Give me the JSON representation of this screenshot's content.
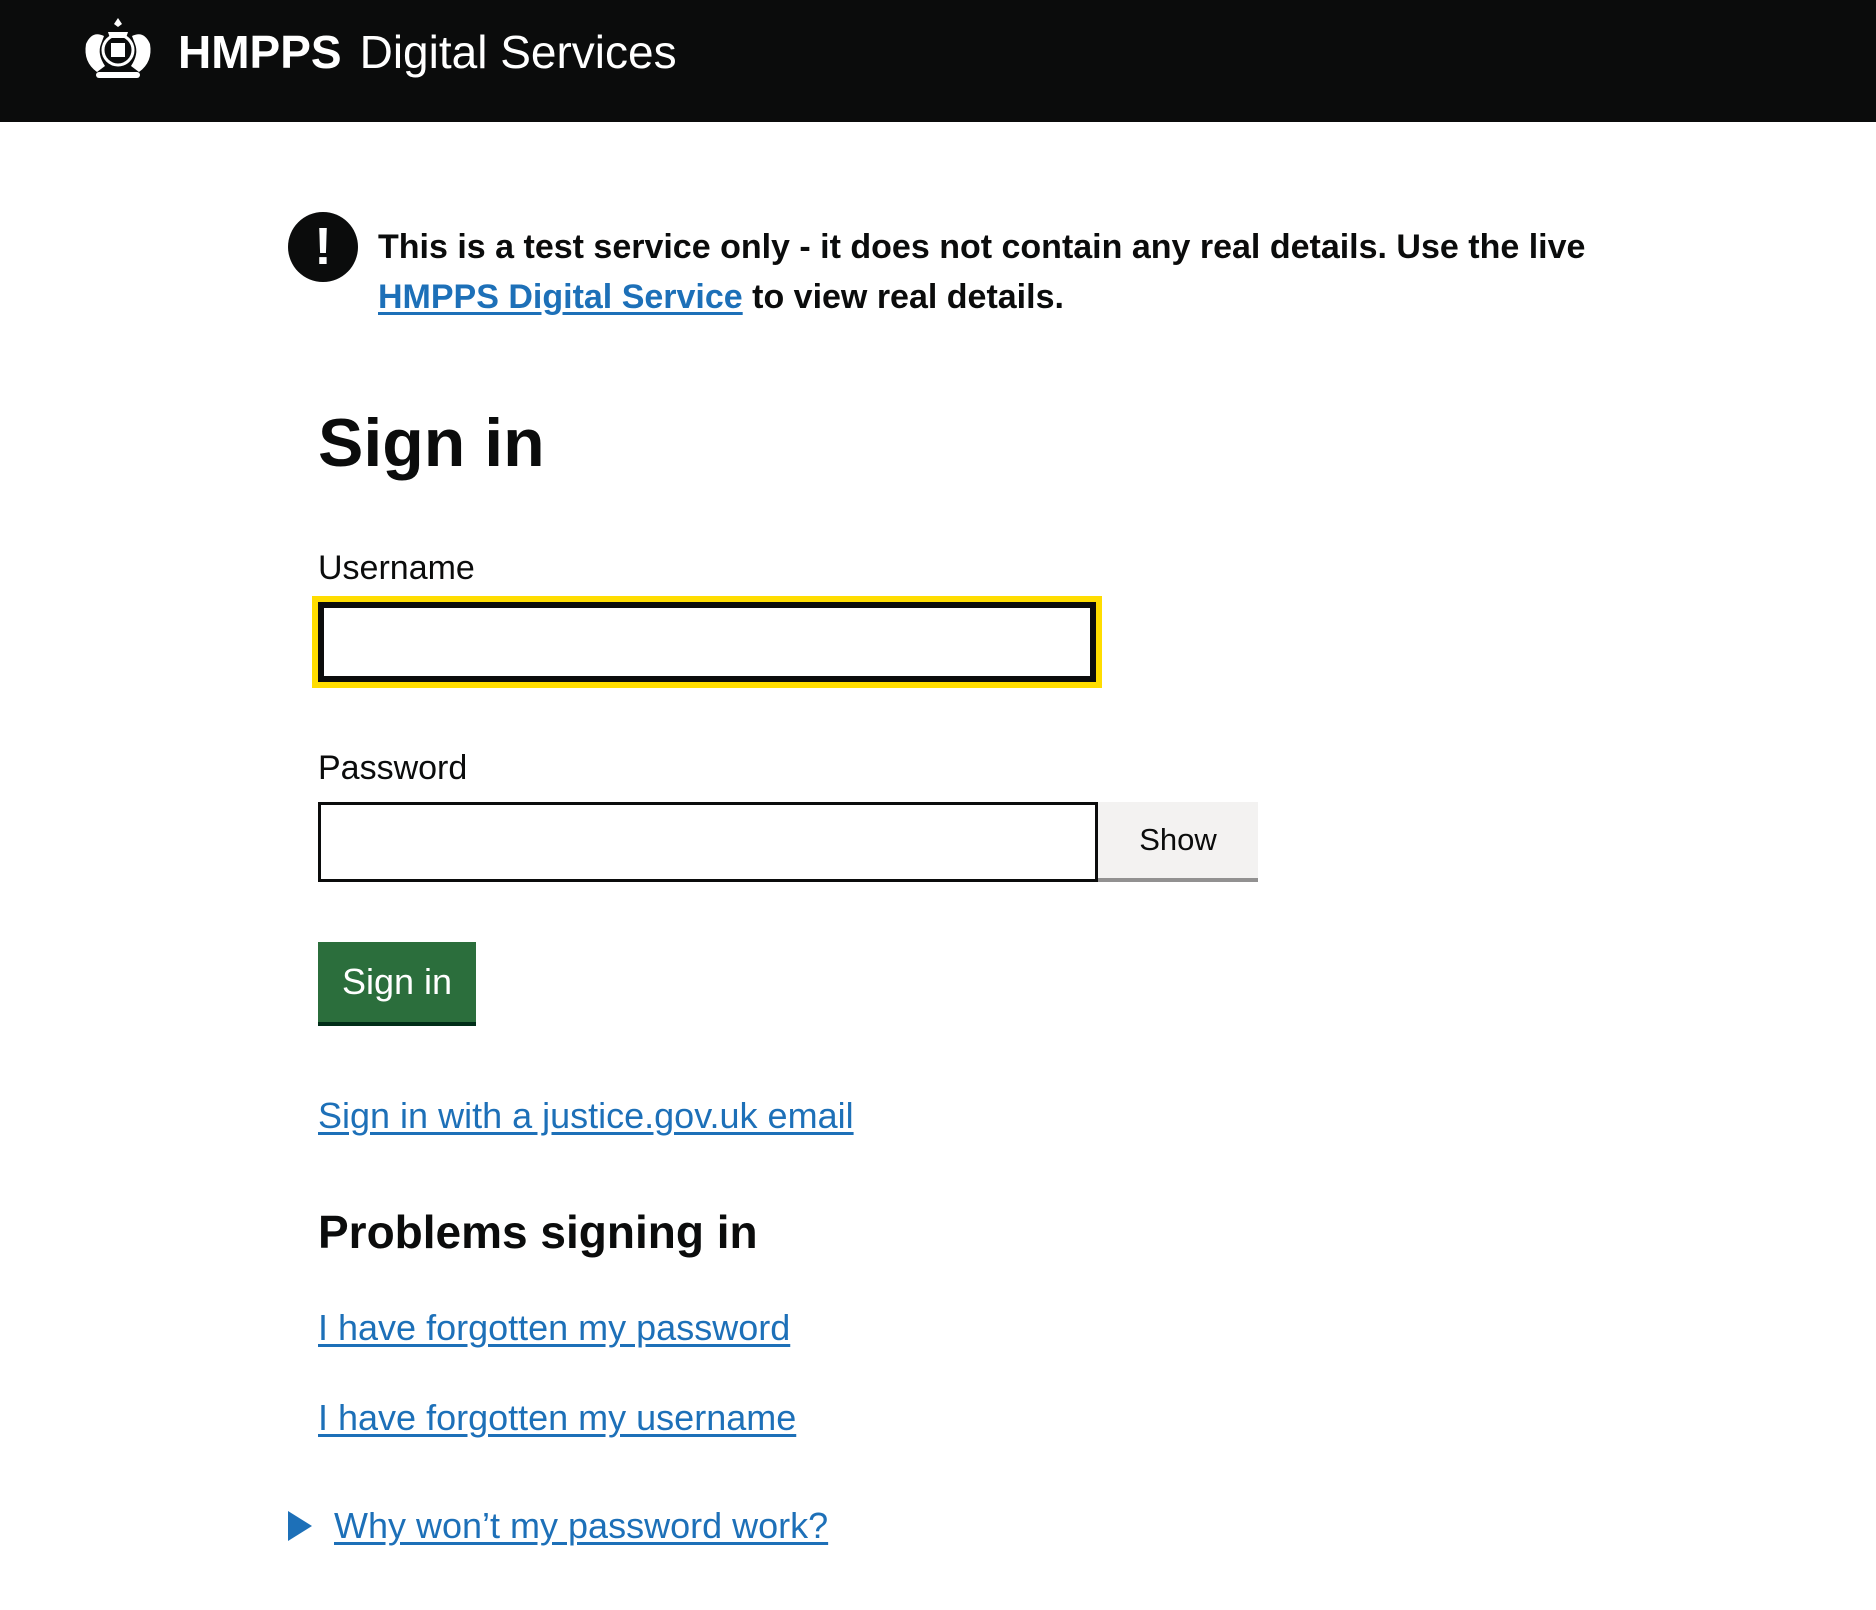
{
  "header": {
    "org_name": "HMPPS",
    "service_name": "Digital Services",
    "logo_icon": "royal-crest-icon"
  },
  "warning": {
    "icon": "exclamation-icon",
    "icon_text": "!",
    "text_before_link": "This is a test service only - it does not contain any real details. Use the live ",
    "link_text": "HMPPS Digital Service",
    "text_after_link": " to view real details."
  },
  "main": {
    "title": "Sign in",
    "username_label": "Username",
    "username_value": "",
    "password_label": "Password",
    "password_value": "",
    "show_button_label": "Show",
    "signin_button_label": "Sign in",
    "justice_link": "Sign in with a justice.gov.uk email"
  },
  "problems": {
    "heading": "Problems signing in",
    "forgot_password_link": "I have forgotten my password",
    "forgot_username_link": "I have forgotten my username",
    "details_summary": "Why won’t my password work?"
  },
  "colors": {
    "header_bg": "#0b0c0c",
    "link": "#1d70b8",
    "button_green": "#2b6e3c",
    "focus_yellow": "#ffdd00"
  }
}
